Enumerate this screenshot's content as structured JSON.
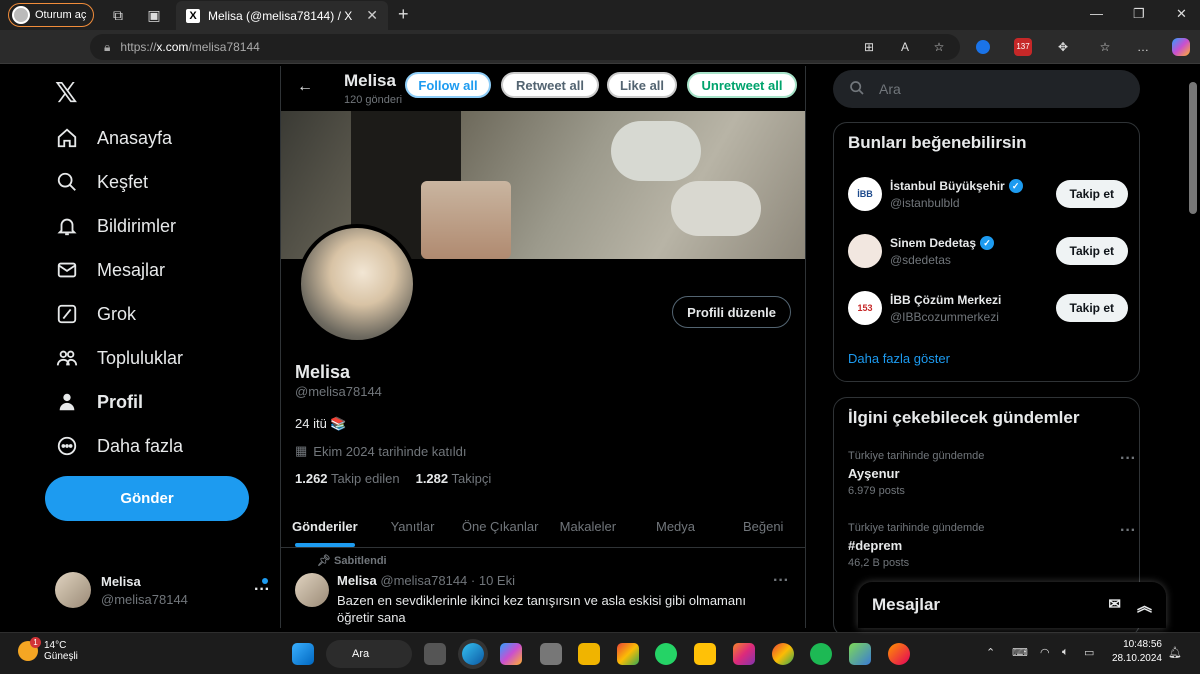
{
  "browser": {
    "profile_label": "Oturum aç",
    "tab_title": "Melisa (@melisa78144) / X",
    "url_prefix": "https://",
    "url_host": "x.com",
    "url_path": "/melisa78144",
    "ext_badge": "137"
  },
  "left_nav": {
    "items": [
      {
        "label": "Anasayfa",
        "icon": "home-icon"
      },
      {
        "label": "Keşfet",
        "icon": "search-icon"
      },
      {
        "label": "Bildirimler",
        "icon": "bell-icon"
      },
      {
        "label": "Mesajlar",
        "icon": "mail-icon"
      },
      {
        "label": "Grok",
        "icon": "grok-icon"
      },
      {
        "label": "Topluluklar",
        "icon": "communities-icon"
      },
      {
        "label": "Profil",
        "icon": "person-icon"
      },
      {
        "label": "Daha fazla",
        "icon": "more-circle-icon"
      }
    ],
    "post_button": "Gönder",
    "account": {
      "name": "Melisa",
      "handle": "@melisa78144"
    }
  },
  "header": {
    "title": "Melisa",
    "post_count": "120 gönderi",
    "buttons": {
      "follow_all": "Follow all",
      "retweet_all": "Retweet all",
      "like_all": "Like all",
      "unretweet_all": "Unretweet all"
    }
  },
  "profile": {
    "edit_button": "Profili düzenle",
    "name": "Melisa",
    "handle": "@melisa78144",
    "bio": "24 itü 📚",
    "joined": "Ekim 2024 tarihinde katıldı",
    "following_count": "1.262",
    "following_label": "Takip edilen",
    "followers_count": "1.282",
    "followers_label": "Takipçi"
  },
  "tabs": [
    "Gönderiler",
    "Yanıtlar",
    "Öne Çıkanlar",
    "Makaleler",
    "Medya",
    "Beğeni"
  ],
  "pinned_tweet": {
    "pinned_label": "Sabitlendi",
    "name": "Melisa",
    "meta": "@melisa78144 · 10 Eki",
    "text": "Bazen en sevdiklerinle ikinci kez tanışırsın ve asla eskisi gibi olmamanı öğretir sana"
  },
  "right": {
    "search_placeholder": "Ara",
    "suggest_title": "Bunları beğenebilirsin",
    "suggestions": [
      {
        "name": "İstanbul Büyükşehir",
        "handle": "@istanbulbld",
        "verified": true,
        "button": "Takip et"
      },
      {
        "name": "Sinem Dedetaş",
        "handle": "@sdedetas",
        "verified": true,
        "button": "Takip et"
      },
      {
        "name": "İBB Çözüm Merkezi",
        "handle": "@IBBcozummerkezi",
        "verified": false,
        "button": "Takip et"
      }
    ],
    "show_more": "Daha fazla göster",
    "trends_title": "İlgini çekebilecek gündemler",
    "trends": [
      {
        "context": "Türkiye tarihinde gündemde",
        "title": "Ayşenur",
        "count": "6.979 posts"
      },
      {
        "context": "Türkiye tarihinde gündemde",
        "title": "#deprem",
        "count": "46,2 B posts"
      }
    ],
    "messages_drawer": "Mesajlar"
  },
  "taskbar": {
    "temperature": "14°C",
    "weather": "Güneşli",
    "weather_badge": "1",
    "search": "Ara",
    "time": "10:48:56",
    "date": "28.10.2024"
  },
  "colors": {
    "accent": "#1d9bf0",
    "background": "#000000",
    "muted": "#71767b"
  }
}
